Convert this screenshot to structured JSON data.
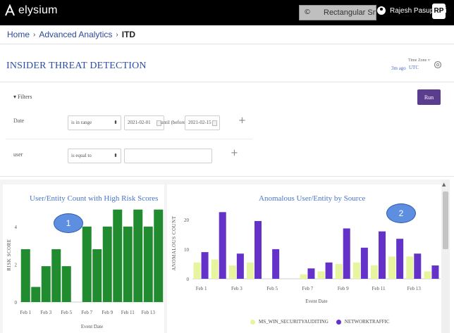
{
  "app": {
    "logo_text": "elysium"
  },
  "topbar": {
    "search_symbol": "©",
    "search_text": "Rectangular Sn",
    "user_name": "Rajesh Pasupuleti",
    "avatar_initials": "RP"
  },
  "breadcrumb": {
    "home": "Home",
    "section": "Advanced Analytics",
    "current": "ITD",
    "sep": "›"
  },
  "header": {
    "title": "INSIDER THREAT DETECTION",
    "ago": "3m ago",
    "timezone_label": "Time Zone ▿",
    "timezone_value": "UTC"
  },
  "filters": {
    "toggle_label": "▾ Filters",
    "run_label": "Run",
    "date_label": "Date",
    "date_operator": "is in range",
    "date_from": "2021-02-01",
    "until_label": "until (before)",
    "date_to": "2021-02-15",
    "user_label": "user",
    "user_operator": "is equal to",
    "user_value": "",
    "plus": "+"
  },
  "callouts": {
    "one": "1",
    "two": "2"
  },
  "scroll": {
    "up": "▲"
  },
  "colors": {
    "chart1_bar": "#218b2f",
    "series_ms": "#e6f59e",
    "series_net": "#6432c8"
  },
  "chart_data": [
    {
      "type": "bar",
      "title": "User/Entity Count with High Risk Scores",
      "xlabel": "Event Date",
      "ylabel": "RISK SCORE",
      "yticks": [
        0,
        2,
        4
      ],
      "ylim": [
        0,
        5
      ],
      "x_ticklabels": [
        "Feb 1",
        "Feb 3",
        "Feb 5",
        "Feb 7",
        "Feb 9",
        "Feb 11",
        "Feb 13"
      ],
      "categories": [
        "Feb 1",
        "Feb 2",
        "Feb 3",
        "Feb 4",
        "Feb 5",
        "Feb 6",
        "Feb 7",
        "Feb 8",
        "Feb 9",
        "Feb 10",
        "Feb 11",
        "Feb 12",
        "Feb 13",
        "Feb 14"
      ],
      "values": [
        2.8,
        0.8,
        1.9,
        2.8,
        1.9,
        0,
        4,
        2.8,
        4,
        4.9,
        4,
        4.9,
        4,
        4.9
      ]
    },
    {
      "type": "bar",
      "title": "Anomalous User/Entity by Source",
      "xlabel": "Event Date",
      "ylabel": "ANOMALOUS COUNT",
      "yticks": [
        0,
        10,
        20
      ],
      "ylim": [
        0,
        24
      ],
      "x_ticklabels": [
        "Feb 1",
        "Feb 3",
        "Feb 5",
        "Feb 7",
        "Feb 9",
        "Feb 11",
        "Feb 13"
      ],
      "categories": [
        "Feb 1",
        "Feb 2",
        "Feb 3",
        "Feb 4",
        "Feb 5",
        "Feb 6",
        "Feb 7",
        "Feb 8",
        "Feb 9",
        "Feb 10",
        "Feb 11",
        "Feb 12",
        "Feb 13",
        "Feb 14"
      ],
      "series": [
        {
          "name": "MS_WIN_SECURITYAUDITING",
          "values": [
            5.5,
            6.5,
            4.5,
            5.5,
            0,
            0,
            1.5,
            2.5,
            5,
            5.5,
            4.5,
            7.5,
            7.5,
            2.5
          ]
        },
        {
          "name": "NETWORKTRAFFIC",
          "values": [
            9,
            22.5,
            8.5,
            19.5,
            10,
            0,
            3.5,
            5.5,
            17,
            10.5,
            16,
            13.5,
            8.5,
            4.5
          ]
        }
      ]
    }
  ]
}
